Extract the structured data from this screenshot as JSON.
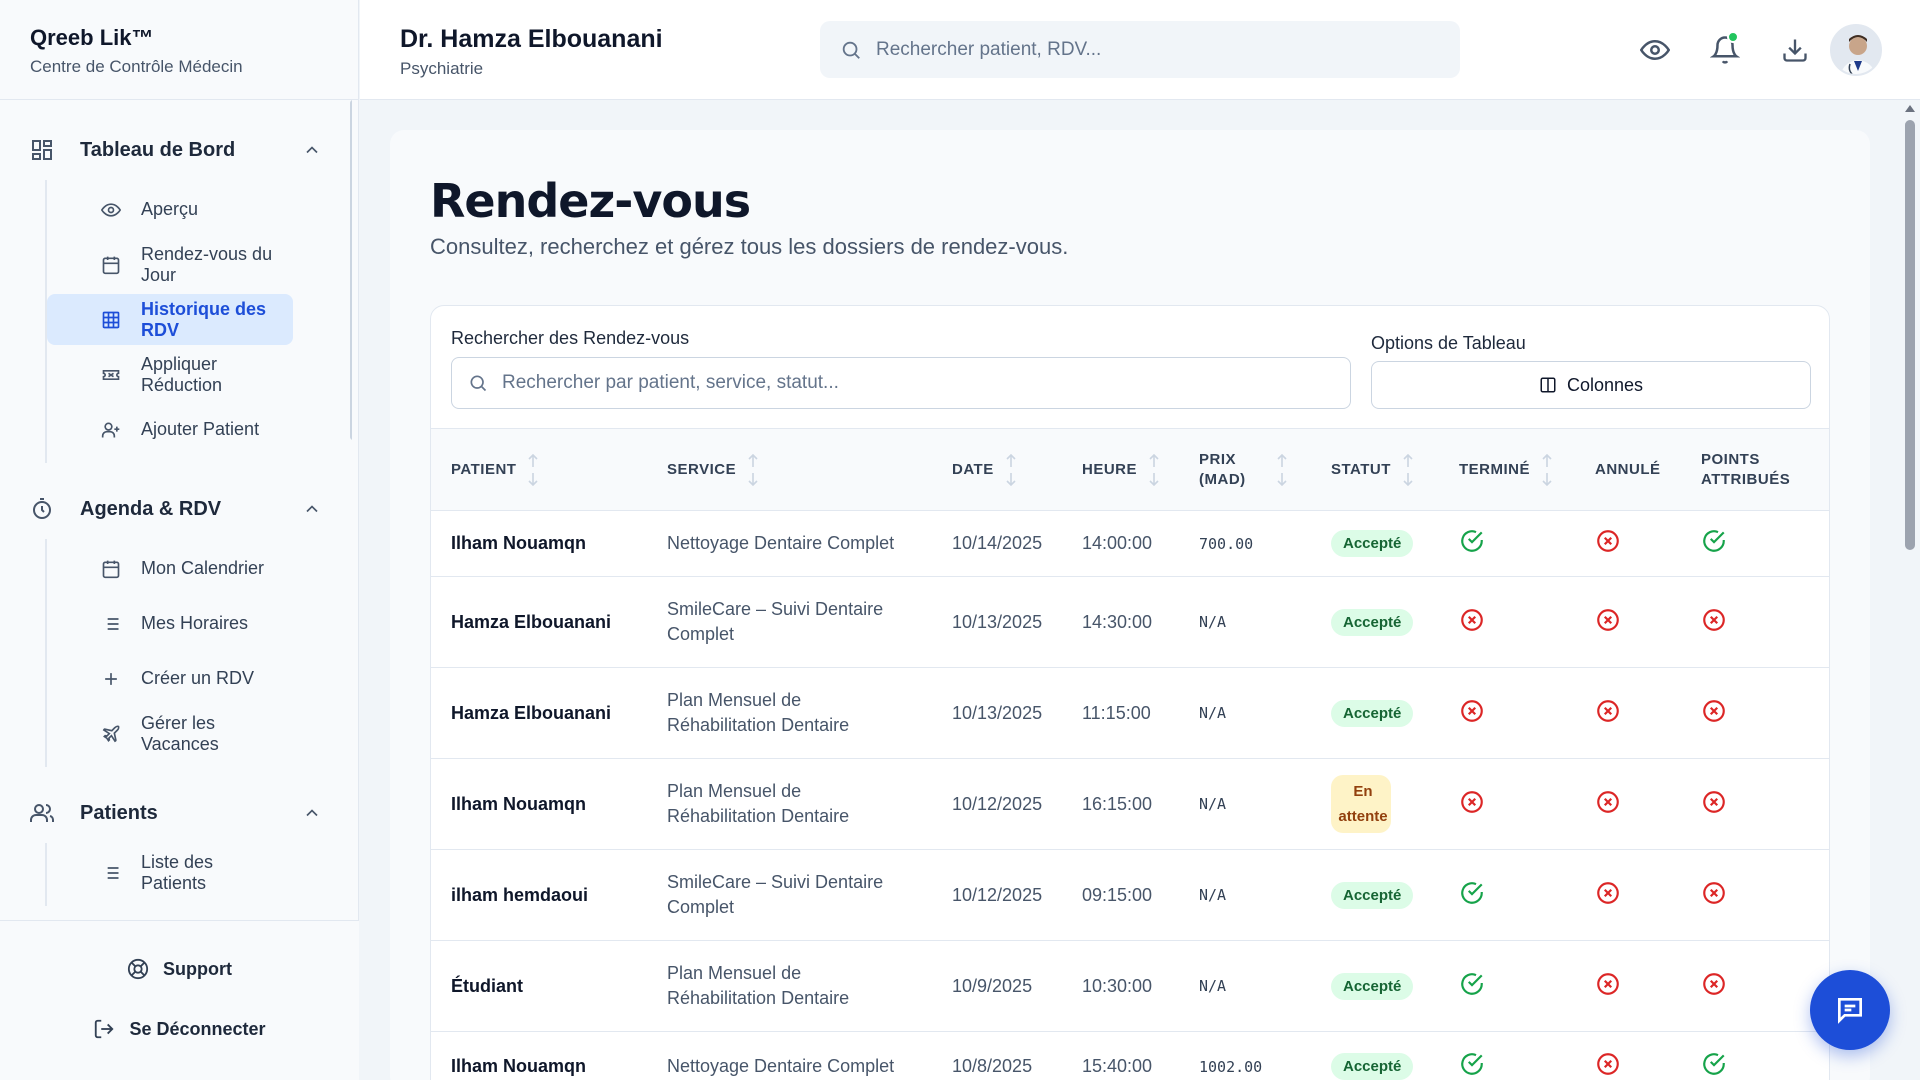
{
  "brand": {
    "name": "Qreeb Lik™",
    "subtitle": "Centre de Contrôle Médecin"
  },
  "sidebar": {
    "groups": [
      {
        "label": "Tableau de Bord",
        "icon": "grid-icon",
        "items": [
          {
            "label": "Aperçu",
            "icon": "eye-icon"
          },
          {
            "label": "Rendez-vous du Jour",
            "icon": "calendar-icon"
          },
          {
            "label": "Historique des RDV",
            "icon": "table-icon",
            "active": true
          },
          {
            "label": "Appliquer Réduction",
            "icon": "ticket-icon"
          },
          {
            "label": "Ajouter Patient",
            "icon": "user-plus-icon"
          }
        ]
      },
      {
        "label": "Agenda & RDV",
        "icon": "timer-icon",
        "items": [
          {
            "label": "Mon Calendrier",
            "icon": "calendar-icon"
          },
          {
            "label": "Mes Horaires",
            "icon": "list-icon"
          },
          {
            "label": "Créer un RDV",
            "icon": "plus-icon"
          },
          {
            "label": "Gérer les Vacances",
            "icon": "plane-icon"
          }
        ]
      },
      {
        "label": "Patients",
        "icon": "users-icon",
        "items": [
          {
            "label": "Liste des Patients",
            "icon": "list-icon"
          }
        ]
      }
    ],
    "footer": {
      "support": "Support",
      "logout": "Se Déconnecter"
    }
  },
  "header": {
    "doctor_name": "Dr. Hamza Elbouanani",
    "specialty": "Psychiatrie",
    "search_placeholder": "Rechercher patient, RDV..."
  },
  "page": {
    "title": "Rendez-vous",
    "subtitle": "Consultez, recherchez et gérez tous les dossiers de rendez-vous.",
    "search_label": "Rechercher des Rendez-vous",
    "search_placeholder": "Rechercher par patient, service, statut...",
    "options_label": "Options de Tableau",
    "columns_button": "Colonnes"
  },
  "table": {
    "headers": [
      {
        "label": "PATIENT",
        "sortable": true
      },
      {
        "label": "SERVICE",
        "sortable": true
      },
      {
        "label": "DATE",
        "sortable": true
      },
      {
        "label": "HEURE",
        "sortable": true
      },
      {
        "label": "PRIX (MAD)",
        "sortable": true
      },
      {
        "label": "STATUT",
        "sortable": true
      },
      {
        "label": "TERMINÉ",
        "sortable": true
      },
      {
        "label": "ANNULÉ",
        "sortable": false
      },
      {
        "label": "POINTS ATTRIBUÉS",
        "sortable": false
      }
    ],
    "rows": [
      {
        "patient": "Ilham Nouamqn",
        "service": "Nettoyage Dentaire Complet",
        "date": "10/14/2025",
        "heure": "14:00:00",
        "prix": "700.00",
        "statut": "Accepté",
        "pending": false,
        "termine": true,
        "annule": false,
        "points": true
      },
      {
        "patient": "Hamza Elbouanani",
        "service": "SmileCare – Suivi Dentaire Complet",
        "date": "10/13/2025",
        "heure": "14:30:00",
        "prix": "N/A",
        "statut": "Accepté",
        "pending": false,
        "termine": false,
        "annule": false,
        "points": false
      },
      {
        "patient": "Hamza Elbouanani",
        "service": "Plan Mensuel de Réhabilitation Dentaire",
        "date": "10/13/2025",
        "heure": "11:15:00",
        "prix": "N/A",
        "statut": "Accepté",
        "pending": false,
        "termine": false,
        "annule": false,
        "points": false
      },
      {
        "patient": "Ilham Nouamqn",
        "service": "Plan Mensuel de Réhabilitation Dentaire",
        "date": "10/12/2025",
        "heure": "16:15:00",
        "prix": "N/A",
        "statut": "En attente",
        "pending": true,
        "termine": false,
        "annule": false,
        "points": false
      },
      {
        "patient": "ilham hemdaoui",
        "service": "SmileCare – Suivi Dentaire Complet",
        "date": "10/12/2025",
        "heure": "09:15:00",
        "prix": "N/A",
        "statut": "Accepté",
        "pending": false,
        "termine": true,
        "annule": false,
        "points": false
      },
      {
        "patient": "Étudiant",
        "service": "Plan Mensuel de Réhabilitation Dentaire",
        "date": "10/9/2025",
        "heure": "10:30:00",
        "prix": "N/A",
        "statut": "Accepté",
        "pending": false,
        "termine": true,
        "annule": false,
        "points": false
      },
      {
        "patient": "Ilham Nouamqn",
        "service": "Nettoyage Dentaire Complet",
        "date": "10/8/2025",
        "heure": "15:40:00",
        "prix": "1002.00",
        "statut": "Accepté",
        "pending": false,
        "termine": true,
        "annule": false,
        "points": true
      }
    ]
  },
  "colors": {
    "accent": "#1d4ed8",
    "success": "#16a34a",
    "danger": "#dc2626",
    "active_bg": "#dbeafe"
  }
}
